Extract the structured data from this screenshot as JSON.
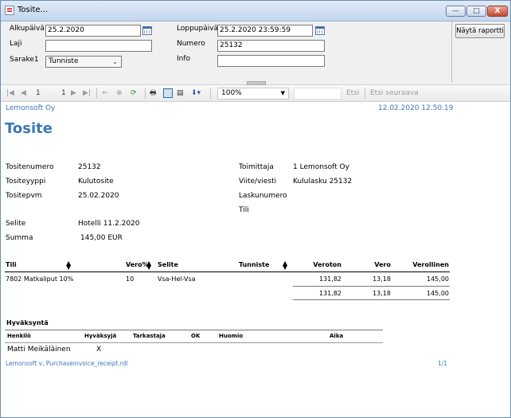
{
  "window": {
    "title": "Tosite..."
  },
  "window_buttons": {
    "minimize": "—",
    "maximize": "□",
    "close": "X"
  },
  "params": {
    "alkupaiva_label": "Alkupäivä",
    "alkupaiva_value": "25.2.2020",
    "loppupaiva_label": "Loppupäivä",
    "loppupaiva_value": "25.2.2020 23:59:59",
    "laji_label": "Laji",
    "laji_value": "",
    "numero_label": "Numero",
    "numero_value": "25132",
    "sarake1_label": "Sarake1",
    "sarake1_value": "Tunniste",
    "info_label": "Info",
    "info_value": "",
    "run_button": "Näytä raportti"
  },
  "toolbar": {
    "page_current": "1",
    "page_total": "1",
    "zoom": "100%",
    "find_label": "Etsi",
    "find_next_label": "Etsi seuraava"
  },
  "report": {
    "company": "Lemonsoft Oy",
    "printed": "12.02.2020 12.50.19",
    "title": "Tosite",
    "fields_left": [
      {
        "label": "Tositenumero",
        "value": "25132"
      },
      {
        "label": "Tositeyyppi",
        "value": "Kulutosite"
      },
      {
        "label": "Tositepvm",
        "value": "25.02.2020"
      }
    ],
    "fields_right": [
      {
        "label": "Toimittaja",
        "value": "1 Lemonsoft Oy"
      },
      {
        "label": "Viite/viesti",
        "value": "Kululasku 25132"
      },
      {
        "label": "Laskunumero",
        "value": ""
      },
      {
        "label": "Tili",
        "value": ""
      }
    ],
    "selite_label": "Selite",
    "selite_value": "Hotelli 11.2.2020",
    "summa_label": "Summa",
    "summa_value": "145,00 EUR",
    "table": {
      "headers": [
        "Tili",
        "Vero%",
        "Selite",
        "Tunniste",
        "Veroton",
        "Vero",
        "Verollinen"
      ],
      "rows": [
        [
          "7802 Matkaliput 10%",
          "10",
          "Vsa-Hel-Vsa",
          "",
          "131,82",
          "13,18",
          "145,00"
        ]
      ],
      "totals": [
        "131,82",
        "13,18",
        "145,00"
      ]
    },
    "approval": {
      "title": "Hyväksyntä",
      "headers": [
        "Henkilö",
        "Hyväksyjä",
        "Tarkastaja",
        "OK",
        "Huomio",
        "Aika"
      ],
      "rows": [
        [
          "Matti Meikäläinen",
          "X",
          "",
          "",
          "",
          ""
        ]
      ]
    },
    "footer_left": "Lemonsoft v, Purchaseinvoice_receipt.rdl",
    "footer_right": "1/1"
  },
  "colors": {
    "accent": "#3c78b4",
    "titlebar": "#c4d6ee",
    "panel": "#f0f0f0"
  }
}
